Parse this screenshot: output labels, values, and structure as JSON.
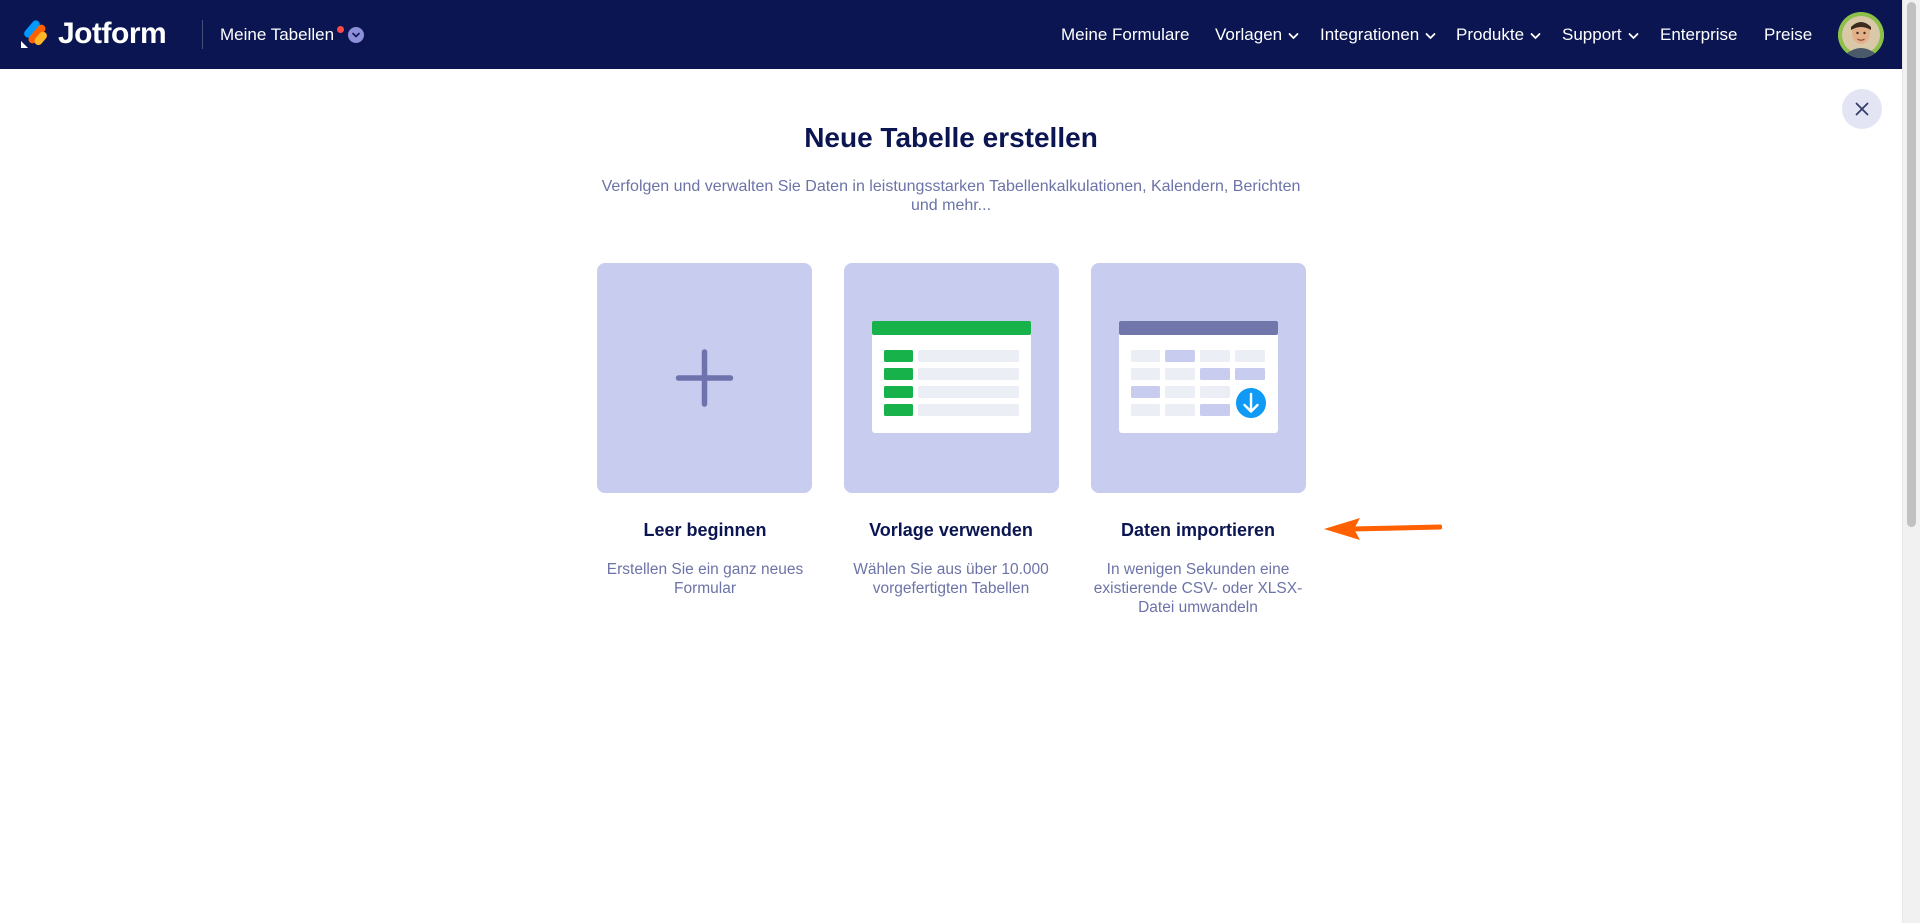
{
  "app": {
    "logo_text": "Jotform",
    "tables_switch_label": "Meine Tabellen"
  },
  "nav": {
    "items": [
      {
        "label": "Meine Formulare",
        "has_dropdown": false
      },
      {
        "label": "Vorlagen",
        "has_dropdown": true
      },
      {
        "label": "Integrationen",
        "has_dropdown": true
      },
      {
        "label": "Produkte",
        "has_dropdown": true
      },
      {
        "label": "Support",
        "has_dropdown": true
      },
      {
        "label": "Enterprise",
        "has_dropdown": false
      },
      {
        "label": "Preise",
        "has_dropdown": false
      }
    ]
  },
  "dialog": {
    "title": "Neue Tabelle erstellen",
    "subtitle": "Verfolgen und verwalten Sie Daten in leistungsstarken Tabellenkalkulationen, Kalendern, Berichten und mehr...",
    "options": [
      {
        "title": "Leer beginnen",
        "description": "Erstellen Sie ein ganz neues Formular",
        "icon": "plus-icon"
      },
      {
        "title": "Vorlage verwenden",
        "description": "Wählen Sie aus über 10.000 vorgefertigten Tabellen",
        "icon": "template-table-icon"
      },
      {
        "title": "Daten importieren",
        "description": "In wenigen Sekunden eine existierende CSV- oder XLSX-Datei umwandeln",
        "icon": "import-table-icon"
      }
    ]
  },
  "colors": {
    "topbar": "#0a1551",
    "card_bg": "#c8cdf0",
    "annotation_arrow": "#ff6100",
    "template_green": "#18b24b",
    "import_blue": "#0f9bf5"
  }
}
